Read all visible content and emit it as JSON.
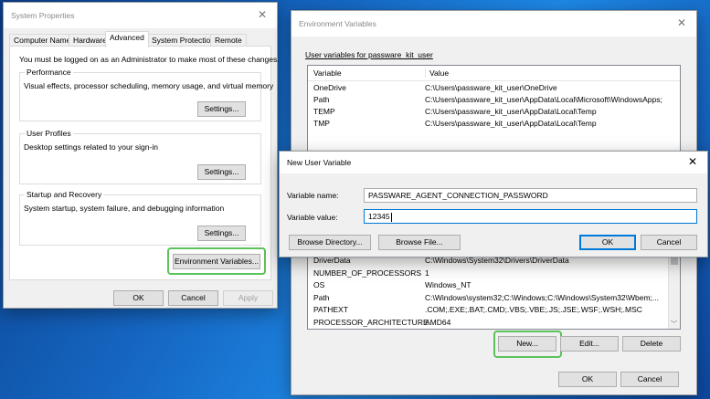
{
  "system_properties": {
    "title": "System Properties",
    "tabs": [
      "Computer Name",
      "Hardware",
      "Advanced",
      "System Protection",
      "Remote"
    ],
    "admin_note": "You must be logged on as an Administrator to make most of these changes.",
    "performance": {
      "label": "Performance",
      "desc": "Visual effects, processor scheduling, memory usage, and virtual memory",
      "button": "Settings..."
    },
    "user_profiles": {
      "label": "User Profiles",
      "desc": "Desktop settings related to your sign-in",
      "button": "Settings..."
    },
    "startup": {
      "label": "Startup and Recovery",
      "desc": "System startup, system failure, and debugging information",
      "button": "Settings..."
    },
    "env_button": "Environment Variables...",
    "ok": "OK",
    "cancel": "Cancel",
    "apply": "Apply"
  },
  "env_vars": {
    "title": "Environment Variables",
    "user_section": "User variables for passware_kit_user",
    "col_variable": "Variable",
    "col_value": "Value",
    "user_rows": [
      {
        "name": "OneDrive",
        "value": "C:\\Users\\passware_kit_user\\OneDrive"
      },
      {
        "name": "Path",
        "value": "C:\\Users\\passware_kit_user\\AppData\\Local\\Microsoft\\WindowsApps;"
      },
      {
        "name": "TEMP",
        "value": "C:\\Users\\passware_kit_user\\AppData\\Local\\Temp"
      },
      {
        "name": "TMP",
        "value": "C:\\Users\\passware_kit_user\\AppData\\Local\\Temp"
      }
    ],
    "system_rows": [
      {
        "name": "DriverData",
        "value": "C:\\Windows\\System32\\Drivers\\DriverData"
      },
      {
        "name": "NUMBER_OF_PROCESSORS",
        "value": "1"
      },
      {
        "name": "OS",
        "value": "Windows_NT"
      },
      {
        "name": "Path",
        "value": "C:\\Windows\\system32;C:\\Windows;C:\\Windows\\System32\\Wbem;..."
      },
      {
        "name": "PATHEXT",
        "value": ".COM;.EXE;.BAT;.CMD;.VBS;.VBE;.JS;.JSE;.WSF;.WSH;.MSC"
      },
      {
        "name": "PROCESSOR_ARCHITECTURE",
        "value": "AMD64"
      }
    ],
    "new_button": "New...",
    "edit_button": "Edit...",
    "delete_button": "Delete",
    "ok": "OK",
    "cancel": "Cancel"
  },
  "new_user_var": {
    "title": "New User Variable",
    "name_label": "Variable name:",
    "name_value": "PASSWARE_AGENT_CONNECTION_PASSWORD",
    "value_label": "Variable value:",
    "value_value": "12345",
    "browse_dir": "Browse Directory...",
    "browse_file": "Browse File...",
    "ok": "OK",
    "cancel": "Cancel"
  },
  "colors": {
    "highlight": "#5dc25a",
    "accent": "#0078d7"
  }
}
